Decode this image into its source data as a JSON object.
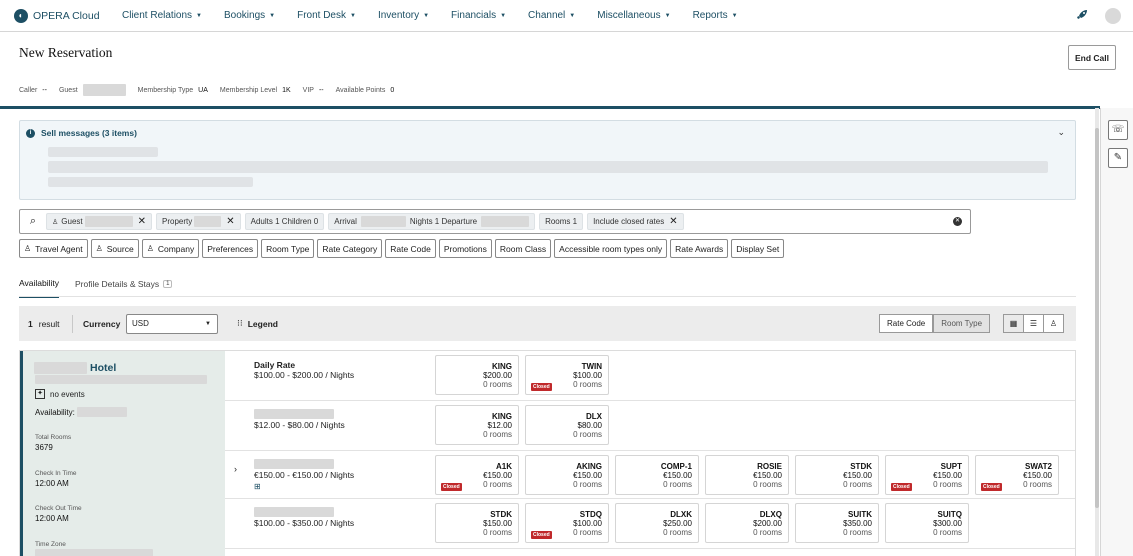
{
  "app": {
    "logo_text": "OPERA Cloud"
  },
  "nav": {
    "items": [
      {
        "label": "Client Relations"
      },
      {
        "label": "Bookings"
      },
      {
        "label": "Front Desk"
      },
      {
        "label": "Inventory"
      },
      {
        "label": "Financials"
      },
      {
        "label": "Channel"
      },
      {
        "label": "Miscellaneous"
      },
      {
        "label": "Reports"
      }
    ]
  },
  "header": {
    "title": "New Reservation",
    "end_call": "End Call",
    "caller_label": "Caller",
    "caller_value": "--",
    "guest_label": "Guest",
    "membership_type_label": "Membership Type",
    "membership_type_value": "UA",
    "membership_level_label": "Membership Level",
    "membership_level_value": "1K",
    "vip_label": "VIP",
    "vip_value": "--",
    "points_label": "Available Points",
    "points_value": "0"
  },
  "sell_messages": {
    "title": "Sell messages (3 items)"
  },
  "search": {
    "chips": {
      "guest": "Guest",
      "property": "Property",
      "adults": "Adults 1  Children  0",
      "arrival": "Arrival",
      "nights": "Nights  1  Departure",
      "rooms": "Rooms  1",
      "closed": "Include closed rates"
    }
  },
  "filters": [
    {
      "label": "Travel Agent",
      "person": true
    },
    {
      "label": "Source",
      "person": true
    },
    {
      "label": "Company",
      "person": true
    },
    {
      "label": "Preferences",
      "person": false
    },
    {
      "label": "Room Type",
      "person": false
    },
    {
      "label": "Rate Category",
      "person": false
    },
    {
      "label": "Rate Code",
      "person": false
    },
    {
      "label": "Promotions",
      "person": false
    },
    {
      "label": "Room Class",
      "person": false
    },
    {
      "label": "Accessible room types only",
      "person": false
    },
    {
      "label": "Rate Awards",
      "person": false
    },
    {
      "label": "Display Set",
      "person": false
    }
  ],
  "tabs": {
    "availability": "Availability",
    "profile": "Profile Details & Stays",
    "profile_count": "1"
  },
  "results_bar": {
    "count": "1",
    "count_label": "result",
    "currency_label": "Currency",
    "currency_value": "USD",
    "legend": "Legend",
    "rate_code": "Rate Code",
    "room_type": "Room Type"
  },
  "hotel": {
    "name": "Hotel",
    "events": "no events",
    "availability_label": "Availability:",
    "total_rooms_label": "Total Rooms",
    "total_rooms_value": "3679",
    "check_in_label": "Check In Time",
    "check_in_value": "12:00 AM",
    "check_out_label": "Check Out Time",
    "check_out_value": "12:00 AM",
    "timezone_label": "Time Zone"
  },
  "closed_label": "Closed",
  "rate_rows": [
    {
      "name": "Daily Rate",
      "range": "$100.00 - $200.00  / Nights",
      "expandable": false,
      "gift": false,
      "cards": [
        {
          "code": "KING",
          "price": "$200.00",
          "rooms": "0 rooms",
          "closed": false
        },
        {
          "code": "TWIN",
          "price": "$100.00",
          "rooms": "0 rooms",
          "closed": true
        }
      ]
    },
    {
      "name": "",
      "range": "$12.00 - $80.00  / Nights",
      "expandable": false,
      "gift": false,
      "cards": [
        {
          "code": "KING",
          "price": "$12.00",
          "rooms": "0 rooms",
          "closed": false
        },
        {
          "code": "DLX",
          "price": "$80.00",
          "rooms": "0 rooms",
          "closed": false
        }
      ]
    },
    {
      "name": "",
      "range": "€150.00 - €150.00  / Nights",
      "expandable": true,
      "gift": true,
      "cards": [
        {
          "code": "A1K",
          "price": "€150.00",
          "rooms": "0 rooms",
          "closed": true
        },
        {
          "code": "AKING",
          "price": "€150.00",
          "rooms": "0 rooms",
          "closed": false
        },
        {
          "code": "COMP-1",
          "price": "€150.00",
          "rooms": "0 rooms",
          "closed": false
        },
        {
          "code": "ROSIE",
          "price": "€150.00",
          "rooms": "0 rooms",
          "closed": false
        },
        {
          "code": "STDK",
          "price": "€150.00",
          "rooms": "0 rooms",
          "closed": false
        },
        {
          "code": "SUPT",
          "price": "€150.00",
          "rooms": "0 rooms",
          "closed": true
        },
        {
          "code": "SWAT2",
          "price": "€150.00",
          "rooms": "0 rooms",
          "closed": true
        }
      ]
    },
    {
      "name": "",
      "range": "$100.00 - $350.00  / Nights",
      "expandable": false,
      "gift": false,
      "cards": [
        {
          "code": "STDK",
          "price": "$150.00",
          "rooms": "0 rooms",
          "closed": false
        },
        {
          "code": "STDQ",
          "price": "$100.00",
          "rooms": "0 rooms",
          "closed": true
        },
        {
          "code": "DLXK",
          "price": "$250.00",
          "rooms": "0 rooms",
          "closed": false
        },
        {
          "code": "DLXQ",
          "price": "$200.00",
          "rooms": "0 rooms",
          "closed": false
        },
        {
          "code": "SUITK",
          "price": "$350.00",
          "rooms": "0 rooms",
          "closed": false
        },
        {
          "code": "SUITQ",
          "price": "$300.00",
          "rooms": "0 rooms",
          "closed": false
        }
      ]
    }
  ]
}
